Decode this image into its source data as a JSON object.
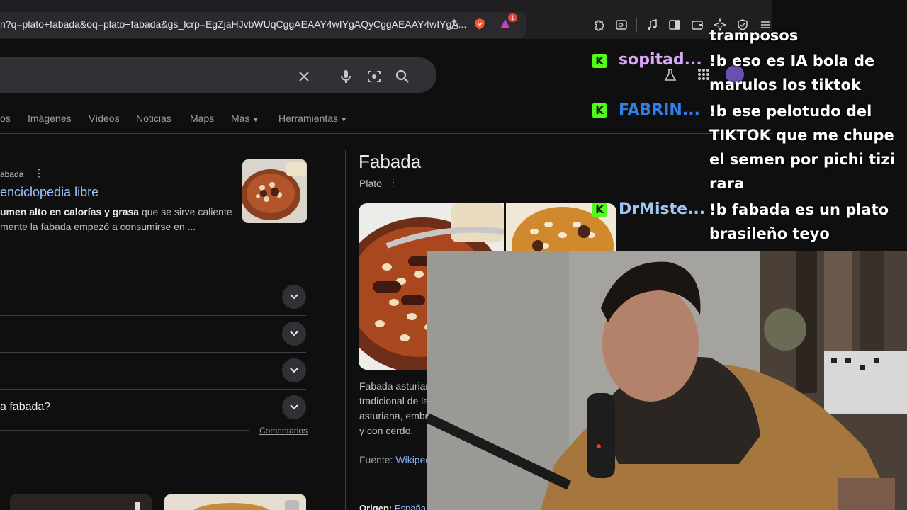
{
  "browser": {
    "url": "n?q=plato+fabada&oq=plato+fabada&gs_lcrp=EgZjaHJvbWUqCggAEAAY4wIYgAQyCggAEAAY4wIYgA...",
    "brave_shield_badge": "",
    "rewards_badge": "1"
  },
  "search": {
    "tabs": [
      "os",
      "Imágenes",
      "Vídeos",
      "Noticias",
      "Maps",
      "Más",
      "Herramientas"
    ]
  },
  "result": {
    "source": "abada",
    "title": "enciclopedia libre",
    "snippet_bold": "umen alto en calorías y grasa",
    "snippet_rest": " que se sirve caliente",
    "snippet_line2": "mente la fabada empezó a consumirse en ..."
  },
  "paa": {
    "last_question": "a fabada?",
    "feedback": "Comentarios"
  },
  "knowledge_panel": {
    "title": "Fabada",
    "subtitle": "Plato",
    "desc_lines": [
      "Fabada asturian",
      "tradicional de la",
      "asturiana, embu",
      "y con cerdo."
    ],
    "source_label": "Fuente: ",
    "source_link": "Wikiped",
    "origin_label": "Origen: ",
    "origin_value": "España"
  },
  "chat": {
    "messages": [
      {
        "user": "",
        "text": "tramposos"
      },
      {
        "user": "sopitad...",
        "color": "#d8a7f5",
        "text": "!b eso es IA bola de marulos los tiktok"
      },
      {
        "user": "FABRIN...",
        "color": "#2f80ed",
        "text": "!b ese pelotudo del TIKTOK que me chupe el semen por pichi tizi rara"
      },
      {
        "user": "DrMiste...",
        "color": "#9fc6f2",
        "text": "!b fabada es un plato brasileño teyo"
      }
    ],
    "badge_letter": "K",
    "badge_color": "#53fc18"
  }
}
